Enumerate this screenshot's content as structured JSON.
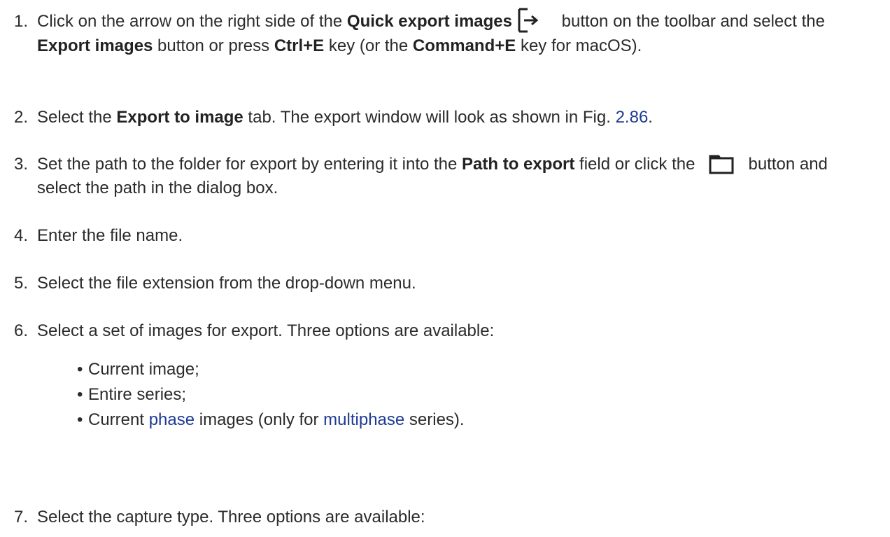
{
  "steps": [
    {
      "num": "1.",
      "t1": "Click on the arrow on the right side of the ",
      "b1": "Quick export images",
      "t2": " button on the toolbar and select the ",
      "b2": "Export images",
      "t3": " button or press ",
      "b3": "Ctrl+E",
      "t4": " key (or the ",
      "b4": "Command+E",
      "t5": " key for macOS)."
    },
    {
      "num": "2.",
      "t1": "Select the ",
      "b1": "Export to image",
      "t2": " tab. The export window will look as shown in Fig. ",
      "link": "2.86",
      "t3": "."
    },
    {
      "num": "3.",
      "t1": "Set the path to the folder for export by entering it into the ",
      "b1": "Path to export",
      "t2": " field or click the",
      "t3": "button and select the path in the dialog box."
    },
    {
      "num": "4.",
      "text": "Enter the file name."
    },
    {
      "num": "5.",
      "text": "Select the file extension from the drop-down menu."
    },
    {
      "num": "6.",
      "text": "Select a set of images for export. Three options are available:"
    },
    {
      "num": "7.",
      "text": "Select the capture type. Three options are available:"
    }
  ],
  "bullets": {
    "mark": "•",
    "b1": "Current image;",
    "b2": "Entire series;",
    "b3_a": "Current ",
    "b3_link1": "phase",
    "b3_b": " images (only for ",
    "b3_link2": "multiphase",
    "b3_c": " series)."
  },
  "icons": {
    "export": "export-arrow-icon",
    "folder": "folder-icon"
  }
}
